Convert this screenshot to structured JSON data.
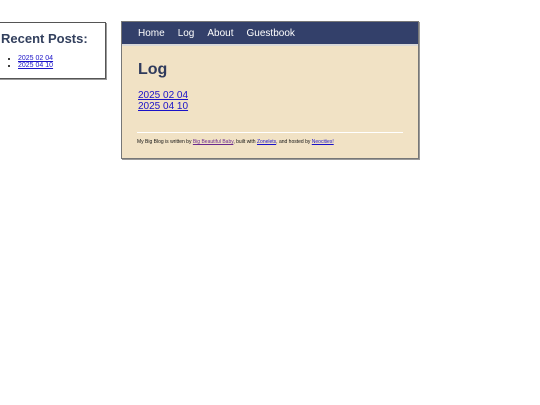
{
  "sidebar": {
    "heading": "Recent Posts:",
    "posts": [
      "2025 02 04",
      "2025 04 10"
    ]
  },
  "nav": {
    "items": [
      "Home",
      "Log",
      "About",
      "Guestbook"
    ]
  },
  "main": {
    "title": "Log",
    "posts": [
      "2025 02 04",
      "2025 04 10"
    ]
  },
  "footer": {
    "part1": "My Big Blog is written by ",
    "author_link": "Big Beautiful Baby",
    "part2": ", built with ",
    "tool_link": "Zonelets",
    "part3": ", and hosted by ",
    "host_link": "Neocities!"
  },
  "colors": {
    "nav_bg": "#33406a",
    "content_bg": "#f1e2c5",
    "heading": "#33405e",
    "link": "#1a12c8",
    "visited_link": "#6a2a8e"
  }
}
